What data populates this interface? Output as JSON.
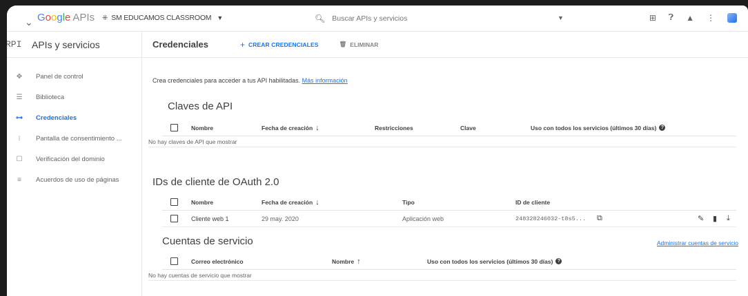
{
  "topbar": {
    "logo": {
      "brand_parts": [
        "G",
        "o",
        "o",
        "g",
        "l",
        "e"
      ],
      "suffix": "APIs"
    },
    "project": "SM EDUCAMOS CLASSROOM",
    "search_placeholder": "Buscar APIs y servicios",
    "icons": [
      "gift-icon",
      "help-icon",
      "bell-icon",
      "more-icon"
    ]
  },
  "sidebar": {
    "badge": "RPI",
    "title": "APIs y servicios",
    "items": [
      {
        "label": "Panel de control",
        "icon": "dashboard-icon"
      },
      {
        "label": "Biblioteca",
        "icon": "library-icon"
      },
      {
        "label": "Credenciales",
        "icon": "key-icon",
        "active": true
      },
      {
        "label": "Pantalla de consentimiento ...",
        "icon": "consent-icon"
      },
      {
        "label": "Verificación del dominio",
        "icon": "domain-icon"
      },
      {
        "label": "Acuerdos de uso de páginas",
        "icon": "agreements-icon"
      }
    ]
  },
  "main": {
    "title": "Credenciales",
    "create_label": "CREAR CREDENCIALES",
    "delete_label": "ELIMINAR",
    "intro_text": "Crea credenciales para acceder a tus API habilitadas.",
    "intro_link": "Más información",
    "api_keys": {
      "title": "Claves de API",
      "headers": [
        "Nombre",
        "Fecha de creación",
        "Restricciones",
        "Clave",
        "Uso con todos los servicios (últimos 30 días)"
      ],
      "empty": "No hay claves de API que mostrar"
    },
    "oauth": {
      "title": "IDs de cliente de OAuth 2.0",
      "headers": [
        "Nombre",
        "Fecha de creación",
        "Tipo",
        "ID de cliente"
      ],
      "rows": [
        {
          "name": "Cliente web 1",
          "date": "29 may. 2020",
          "type": "Aplicación web",
          "client_id": "248328246032-t8s5..."
        }
      ]
    },
    "service_accounts": {
      "title": "Cuentas de servicio",
      "manage_link": "Administrar cuentas de servicio",
      "headers": [
        "Correo electrónico",
        "Nombre",
        "Uso con todos los servicios (últimos 30 días)"
      ],
      "empty": "No hay cuentas de servicio que mostrar"
    }
  }
}
